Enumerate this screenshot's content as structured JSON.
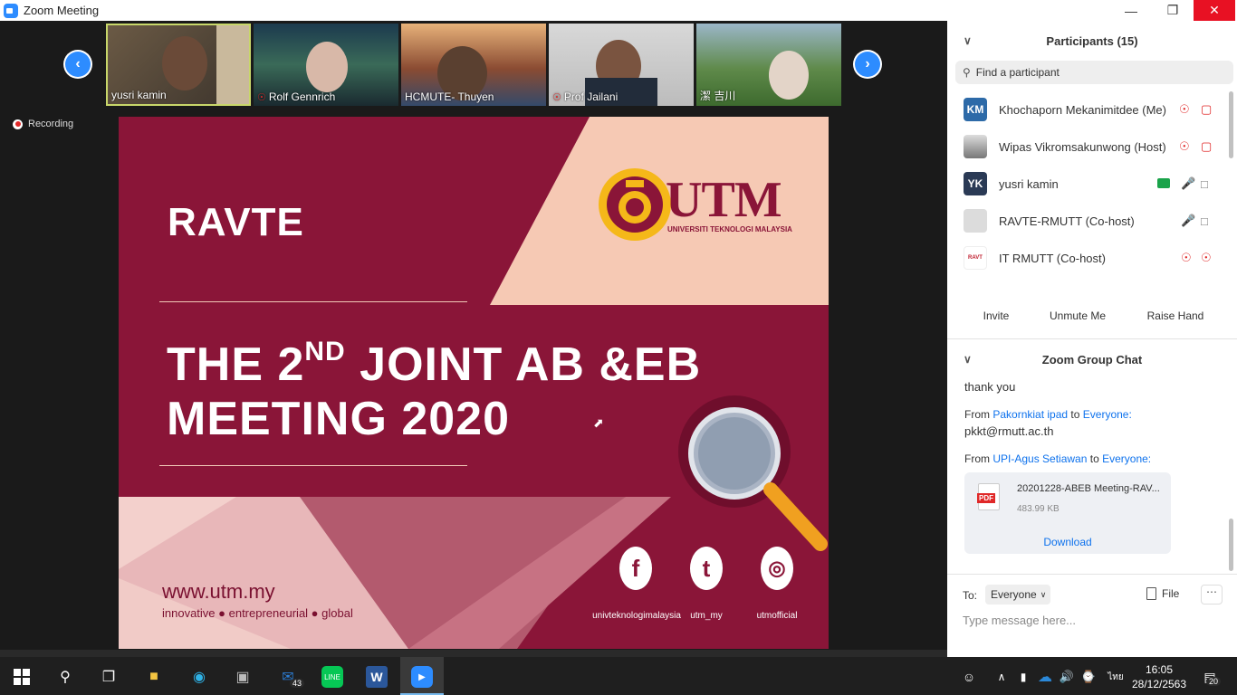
{
  "window": {
    "title": "Zoom Meeting"
  },
  "gallery": {
    "participants": [
      {
        "name": "yusri kamin",
        "muted": false,
        "active": true
      },
      {
        "name": "Rolf Gennrich",
        "muted": true
      },
      {
        "name": "HCMUTE- Thuyen",
        "muted": false
      },
      {
        "name": "Prof Jailani",
        "muted": true
      },
      {
        "name": "潔 吉川",
        "muted": false
      }
    ]
  },
  "recording": {
    "label": "Recording"
  },
  "slide": {
    "kicker": "RAVTE",
    "headline_pre": "THE 2",
    "headline_sup": "ND",
    "headline_post": " JOINT AB &EB",
    "headline_line2": "MEETING 2020",
    "logo_text": "UTM",
    "logo_sub": "UNIVERSITI TEKNOLOGI MALAYSIA",
    "url": "www.utm.my",
    "tagline": "innovative ● entrepreneurial ● global",
    "social": [
      {
        "icon": "facebook-icon",
        "glyph": "f",
        "label": "univteknologimalaysia"
      },
      {
        "icon": "twitter-icon",
        "glyph": "t",
        "label": "utm_my"
      },
      {
        "icon": "instagram-icon",
        "glyph": "◎",
        "label": "utmofficial"
      }
    ],
    "colors": {
      "maroon": "#8a1538",
      "peach": "#f6c9b4",
      "pink": "#d4808e"
    }
  },
  "participants_panel": {
    "title": "Participants (15)",
    "search_placeholder": "Find a participant",
    "list": [
      {
        "initials": "KM",
        "name": "Khochaporn Mekanimitdee (Me)",
        "avatar_color": "#2d6aa8"
      },
      {
        "initials": "",
        "name": "Wipas Vikromsakunwong (Host)",
        "avatar_color": "#999999"
      },
      {
        "initials": "YK",
        "name": "yusri kamin",
        "avatar_color": "#2a3a55"
      },
      {
        "initials": "",
        "name": "RAVTE-RMUTT (Co-host)",
        "avatar_color": "#cccccc"
      },
      {
        "initials": "RAVT",
        "name": "IT RMUTT (Co-host)",
        "avatar_color": "#ffffff"
      }
    ],
    "buttons": {
      "invite": "Invite",
      "unmute": "Unmute Me",
      "raise": "Raise Hand"
    }
  },
  "chat": {
    "title": "Zoom Group Chat",
    "messages": [
      {
        "text": "thank you"
      },
      {
        "from_prefix": "From",
        "sender": "Pakornkiat ipad",
        "to_word": "to",
        "recipient": "Everyone:",
        "text": "pkkt@rmutt.ac.th"
      },
      {
        "from_prefix": "From",
        "sender": "UPI-Agus Setiawan",
        "to_word": "to",
        "recipient": "Everyone:"
      }
    ],
    "file": {
      "badge": "PDF",
      "name": "20201228-ABEB Meeting-RAV...",
      "size": "483.99 KB",
      "download": "Download"
    },
    "to_label": "To:",
    "to_value": "Everyone",
    "file_button": "File",
    "input_placeholder": "Type message here..."
  },
  "taskbar": {
    "mail_badge": "43",
    "ime": "ไทย",
    "time": "16:05",
    "date": "28/12/2563",
    "notif_count": "20"
  }
}
